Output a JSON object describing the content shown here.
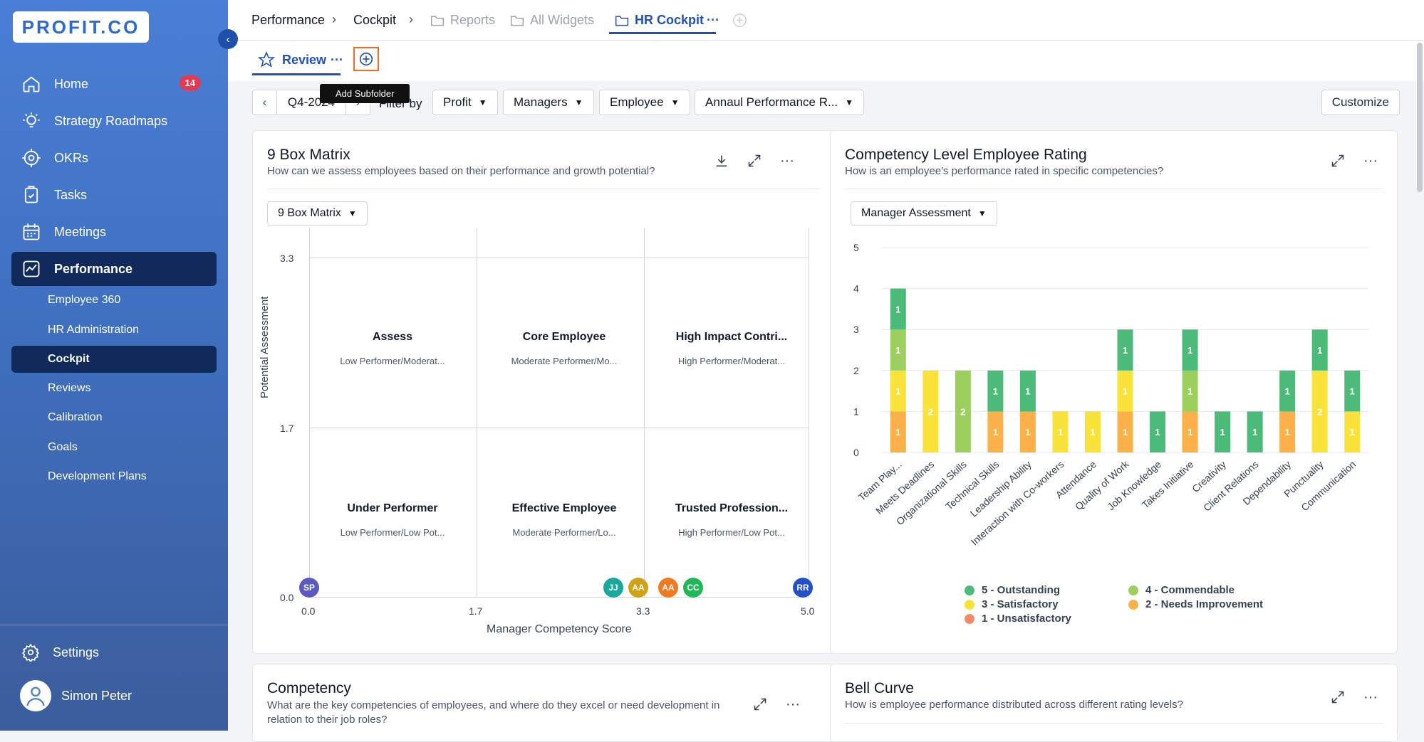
{
  "app": {
    "logo_text": "PROFIT.CO"
  },
  "sidebar": {
    "items": [
      {
        "label": "Home",
        "badge": "14"
      },
      {
        "label": "Strategy Roadmaps"
      },
      {
        "label": "OKRs"
      },
      {
        "label": "Tasks"
      },
      {
        "label": "Meetings"
      },
      {
        "label": "Performance"
      }
    ],
    "subitems": [
      "Employee 360",
      "HR Administration",
      "Cockpit",
      "Reviews",
      "Calibration",
      "Goals",
      "Development Plans"
    ],
    "settings": "Settings",
    "user": "Simon Peter"
  },
  "breadcrumb": {
    "performance": "Performance",
    "cockpit": "Cockpit",
    "reports": "Reports",
    "all_widgets": "All Widgets",
    "hr_cockpit": "HR Cockpit",
    "more": "···"
  },
  "tabs": {
    "review": "Review",
    "more": "···",
    "tooltip": "Add Subfolder"
  },
  "filters": {
    "period": "Q4-2024",
    "filter_by": "Filter by",
    "profit": "Profit",
    "managers": "Managers",
    "employee": "Employee",
    "annual": "Annaul Performance R...",
    "customize": "Customize"
  },
  "nine_box": {
    "title": "9 Box Matrix",
    "subtitle": "How can we assess employees based on their performance and growth potential?",
    "dropdown": "9 Box Matrix",
    "y_label": "Potential Assessment",
    "x_label": "Manager Competency Score",
    "y_ticks": [
      "3.3",
      "1.7",
      "0.0"
    ],
    "x_ticks": [
      "0.0",
      "1.7",
      "3.3",
      "5.0"
    ],
    "cells": [
      {
        "title": "Assess",
        "sub": "Low Performer/Moderat..."
      },
      {
        "title": "Core Employee",
        "sub": "Moderate Performer/Mo..."
      },
      {
        "title": "High Impact Contri...",
        "sub": "High Performer/Moderat..."
      },
      {
        "title": "Under Performer",
        "sub": "Low Performer/Low Pot..."
      },
      {
        "title": "Effective Employee",
        "sub": "Moderate Performer/Lo..."
      },
      {
        "title": "Trusted Profession...",
        "sub": "High Performer/Low Pot..."
      }
    ],
    "employees": [
      {
        "initials": "SP",
        "color": "#5a5bc0",
        "x": 0.0
      },
      {
        "initials": "JJ",
        "color": "#1aa89a",
        "x": 3.05
      },
      {
        "initials": "AA",
        "color": "#d0a21a",
        "x": 3.3
      },
      {
        "initials": "AA",
        "color": "#f07a22",
        "x": 3.6
      },
      {
        "initials": "CC",
        "color": "#22b85a",
        "x": 3.85
      },
      {
        "initials": "RR",
        "color": "#2450c8",
        "x": 4.95
      }
    ]
  },
  "competency_rating": {
    "title": "Competency Level Employee Rating",
    "subtitle": "How is an employee's performance rated in specific competencies?",
    "dropdown": "Manager Assessment"
  },
  "chart_data": {
    "type": "bar",
    "stacked": true,
    "ylim": [
      0,
      5
    ],
    "y_ticks": [
      "0",
      "1",
      "2",
      "3",
      "4",
      "5"
    ],
    "categories": [
      "Team Play...",
      "Meets Deadlines",
      "Organizational Skills",
      "Technical Skills",
      "Leadership Ability",
      "Interaction with Co-workers",
      "Attendance",
      "Quality of Work",
      "Job Knowledge",
      "Takes Initiative",
      "Creativity",
      "Client Relations",
      "Dependability",
      "Punctuality",
      "Communication"
    ],
    "series": [
      {
        "name": "1 - Unsatisfactory",
        "color": "#f58a6b",
        "values": [
          0,
          0,
          0,
          0,
          0,
          0,
          0,
          0,
          0,
          0,
          0,
          0,
          0,
          0,
          0
        ]
      },
      {
        "name": "2 - Needs Improvement",
        "color": "#fbb04a",
        "values": [
          1,
          0,
          0,
          1,
          1,
          0,
          0,
          1,
          0,
          1,
          0,
          0,
          1,
          0,
          0
        ]
      },
      {
        "name": "3 - Satisfactory",
        "color": "#f9e33a",
        "values": [
          1,
          2,
          0,
          0,
          0,
          1,
          1,
          1,
          0,
          0,
          0,
          0,
          0,
          2,
          1
        ]
      },
      {
        "name": "4 - Commendable",
        "color": "#9ccf5e",
        "values": [
          1,
          0,
          2,
          0,
          0,
          0,
          0,
          0,
          0,
          1,
          0,
          0,
          0,
          0,
          0
        ]
      },
      {
        "name": "5 - Outstanding",
        "color": "#4cba78",
        "values": [
          1,
          0,
          0,
          1,
          1,
          0,
          0,
          1,
          1,
          1,
          1,
          1,
          1,
          1,
          1
        ]
      }
    ],
    "legend": [
      "5 - Outstanding",
      "4 - Commendable",
      "3 - Satisfactory",
      "2 - Needs Improvement",
      "1 - Unsatisfactory"
    ]
  },
  "competency": {
    "title": "Competency",
    "subtitle": "What are the key competencies of employees, and where do they excel or need development in relation to their job roles?"
  },
  "bell_curve": {
    "title": "Bell Curve",
    "subtitle": "How is employee performance distributed across different rating levels?"
  }
}
